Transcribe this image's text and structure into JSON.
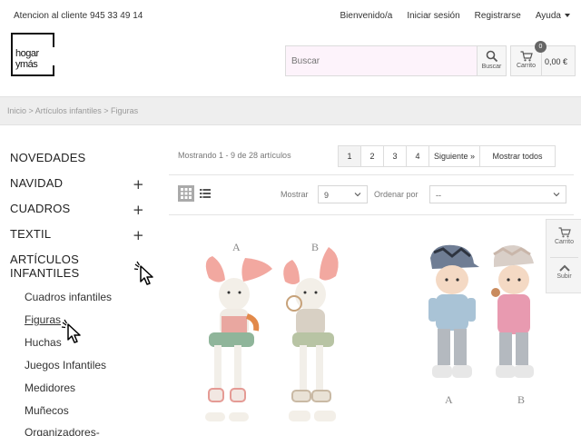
{
  "topbar": {
    "contact": "Atencion al cliente 945 33 49 14",
    "welcome": "Bienvenido/a",
    "login": "Iniciar sesión",
    "register": "Registrarse",
    "help": "Ayuda"
  },
  "logo": {
    "line1": "hogar",
    "line2": "ymás"
  },
  "search": {
    "placeholder": "Buscar",
    "button_label": "Buscar"
  },
  "cart": {
    "label": "Carrito",
    "count": "0",
    "total": "0,00 €"
  },
  "breadcrumb": "Inicio > Artículos infantiles > Figuras",
  "sidebar": {
    "categories": [
      {
        "label": "NOVEDADES",
        "expand": ""
      },
      {
        "label": "NAVIDAD",
        "expand": "+"
      },
      {
        "label": "CUADROS",
        "expand": "+"
      },
      {
        "label": "TEXTIL",
        "expand": "+"
      },
      {
        "label": "ARTÍCULOS",
        "label2": "INFANTILES",
        "expand": ""
      }
    ],
    "subcategories": [
      {
        "label": "Cuadros infantiles"
      },
      {
        "label": "Figuras"
      },
      {
        "label": "Huchas"
      },
      {
        "label": "Juegos Infantiles"
      },
      {
        "label": "Medidores"
      },
      {
        "label": "Muñecos"
      },
      {
        "label": "Organizadores-"
      }
    ]
  },
  "listing": {
    "count_text": "Mostrando 1 - 9 de 28 artículos",
    "pages": [
      "1",
      "2",
      "3",
      "4"
    ],
    "current_page": "1",
    "next_label": "Siguiente »",
    "show_all_label": "Mostrar todos",
    "show_label": "Mostrar",
    "show_value": "9",
    "order_label": "Ordenar por",
    "order_value": "--"
  },
  "side_tools": {
    "cart_label": "Carrito",
    "up_label": "Subir"
  },
  "products": [
    {
      "label_a": "A",
      "label_b": "B"
    },
    {
      "label_a": "A",
      "label_b": "B"
    }
  ],
  "colors": {
    "accent": "#333333",
    "search_bg": "#fdf3fb",
    "breadcrumb_bg": "#eeeeee"
  }
}
